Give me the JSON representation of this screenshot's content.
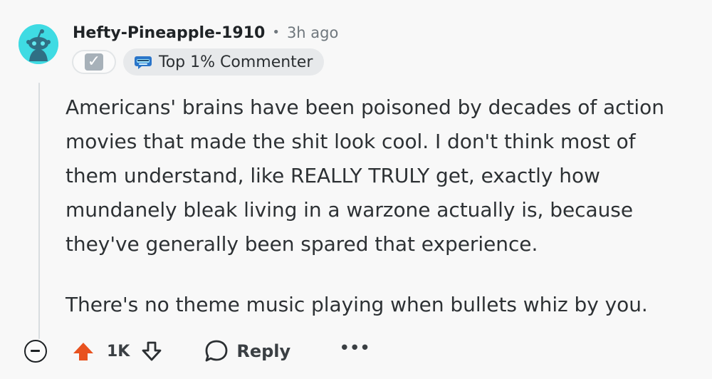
{
  "comment": {
    "author": "Hefty-Pineapple-1910",
    "separator": "•",
    "timestamp": "3h ago",
    "check_badge": "✓",
    "achievement": "Top 1% Commenter",
    "body": [
      "Americans' brains have been poisoned by decades of action movies that made the shit look cool. I don't think most of them understand, like REALLY TRULY get, exactly how mundanely bleak living in a warzone actually is, because they've generally been spared that experience.",
      "There's no theme music playing when bullets whiz by you."
    ],
    "score": "1K",
    "reply_label": "Reply",
    "more_label": "•••"
  },
  "icons": {
    "avatar": "snoo-avatar-icon",
    "collapse": "collapse-thread-icon",
    "upvote": "upvote-arrow-icon",
    "downvote": "downvote-arrow-icon",
    "reply": "speech-bubble-icon",
    "achievement": "comment-achievement-icon"
  },
  "colors": {
    "avatar": "#3fdbe3",
    "upvote_active": "#e8521f",
    "text": "#2d3134",
    "muted": "#6f777d"
  }
}
